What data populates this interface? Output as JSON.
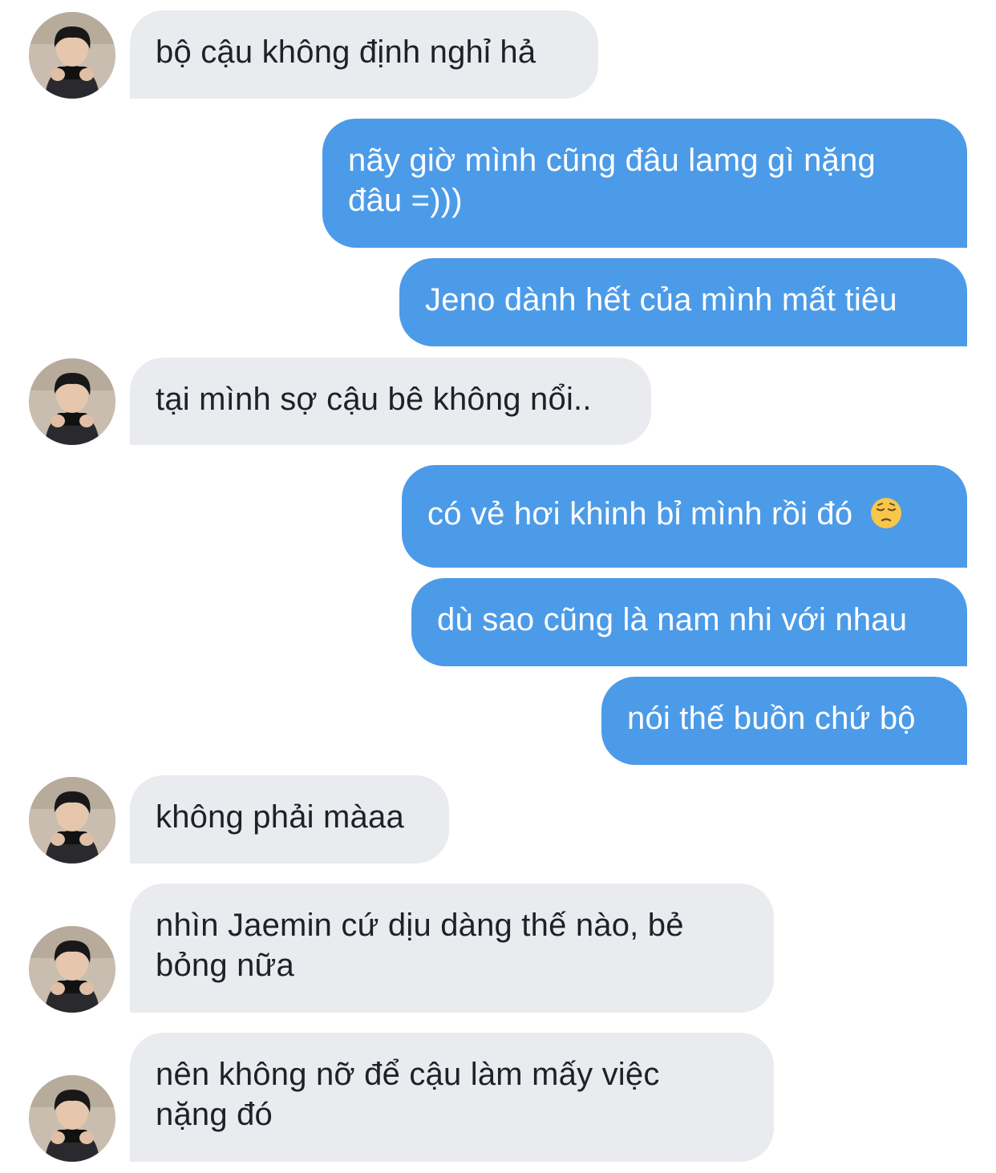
{
  "conversation": {
    "messages": [
      {
        "sender": "other",
        "text": "bộ cậu không định nghỉ hả"
      },
      {
        "sender": "me",
        "text": "nãy giờ mình cũng đâu lamg gì nặng\nđâu =)))"
      },
      {
        "sender": "me",
        "text": "Jeno dành hết của mình mất tiêu"
      },
      {
        "sender": "other",
        "text": "tại mình sợ cậu bê không nổi.."
      },
      {
        "sender": "me",
        "text": "có vẻ hơi khinh bỉ mình rồi đó",
        "emoji": "pensive-face-emoji"
      },
      {
        "sender": "me",
        "text": "dù sao cũng là nam nhi với nhau"
      },
      {
        "sender": "me",
        "text": "nói thế buồn chứ bộ"
      },
      {
        "sender": "other",
        "text": "không phải màaa"
      },
      {
        "sender": "other",
        "text": "nhìn Jaemin cứ dịu dàng thế nào, bẻ\nbỏng nữa"
      },
      {
        "sender": "other",
        "text": "nên không nỡ để cậu làm mấy việc\nnặng đó"
      }
    ]
  },
  "colors": {
    "incoming_bubble": "#e9ebef",
    "incoming_text": "#1d222a",
    "outgoing_bubble": "#4c9be8",
    "outgoing_text": "#ffffff",
    "background": "#ffffff"
  },
  "icons": {
    "avatar": "contact-avatar-photo",
    "emoji": "pensive-face-emoji"
  }
}
